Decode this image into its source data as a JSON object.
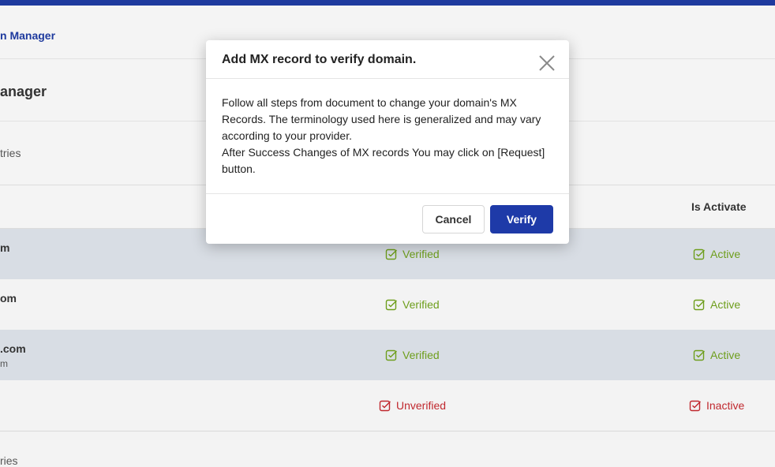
{
  "breadcrumb": "n Manager",
  "page_title": "anager",
  "entries_label": "tries",
  "footer_entries_label": "ries",
  "table": {
    "col_is_activate": "Is Activate",
    "rows": [
      {
        "domain": "m",
        "sub": "",
        "verify": "Verified",
        "activate": "Active",
        "verified": true,
        "active": true
      },
      {
        "domain": "om",
        "sub": "",
        "verify": "Verified",
        "activate": "Active",
        "verified": true,
        "active": true
      },
      {
        "domain": ".com",
        "sub": "m",
        "verify": "Verified",
        "activate": "Active",
        "verified": true,
        "active": true
      },
      {
        "domain": "",
        "sub": "",
        "verify": "Unverified",
        "activate": "Inactive",
        "verified": false,
        "active": false
      }
    ]
  },
  "modal": {
    "title": "Add MX record to verify domain.",
    "body_1": "Follow all steps from document to change your domain's MX Records. The terminology used here is generalized and may vary according to your provider.",
    "body_2": "After Success Changes of MX records You may click on [Request] button.",
    "cancel_label": "Cancel",
    "verify_label": "Verify"
  },
  "colors": {
    "accent": "#1e3aa8",
    "success": "#6e9e1c",
    "danger": "#c0282e"
  }
}
